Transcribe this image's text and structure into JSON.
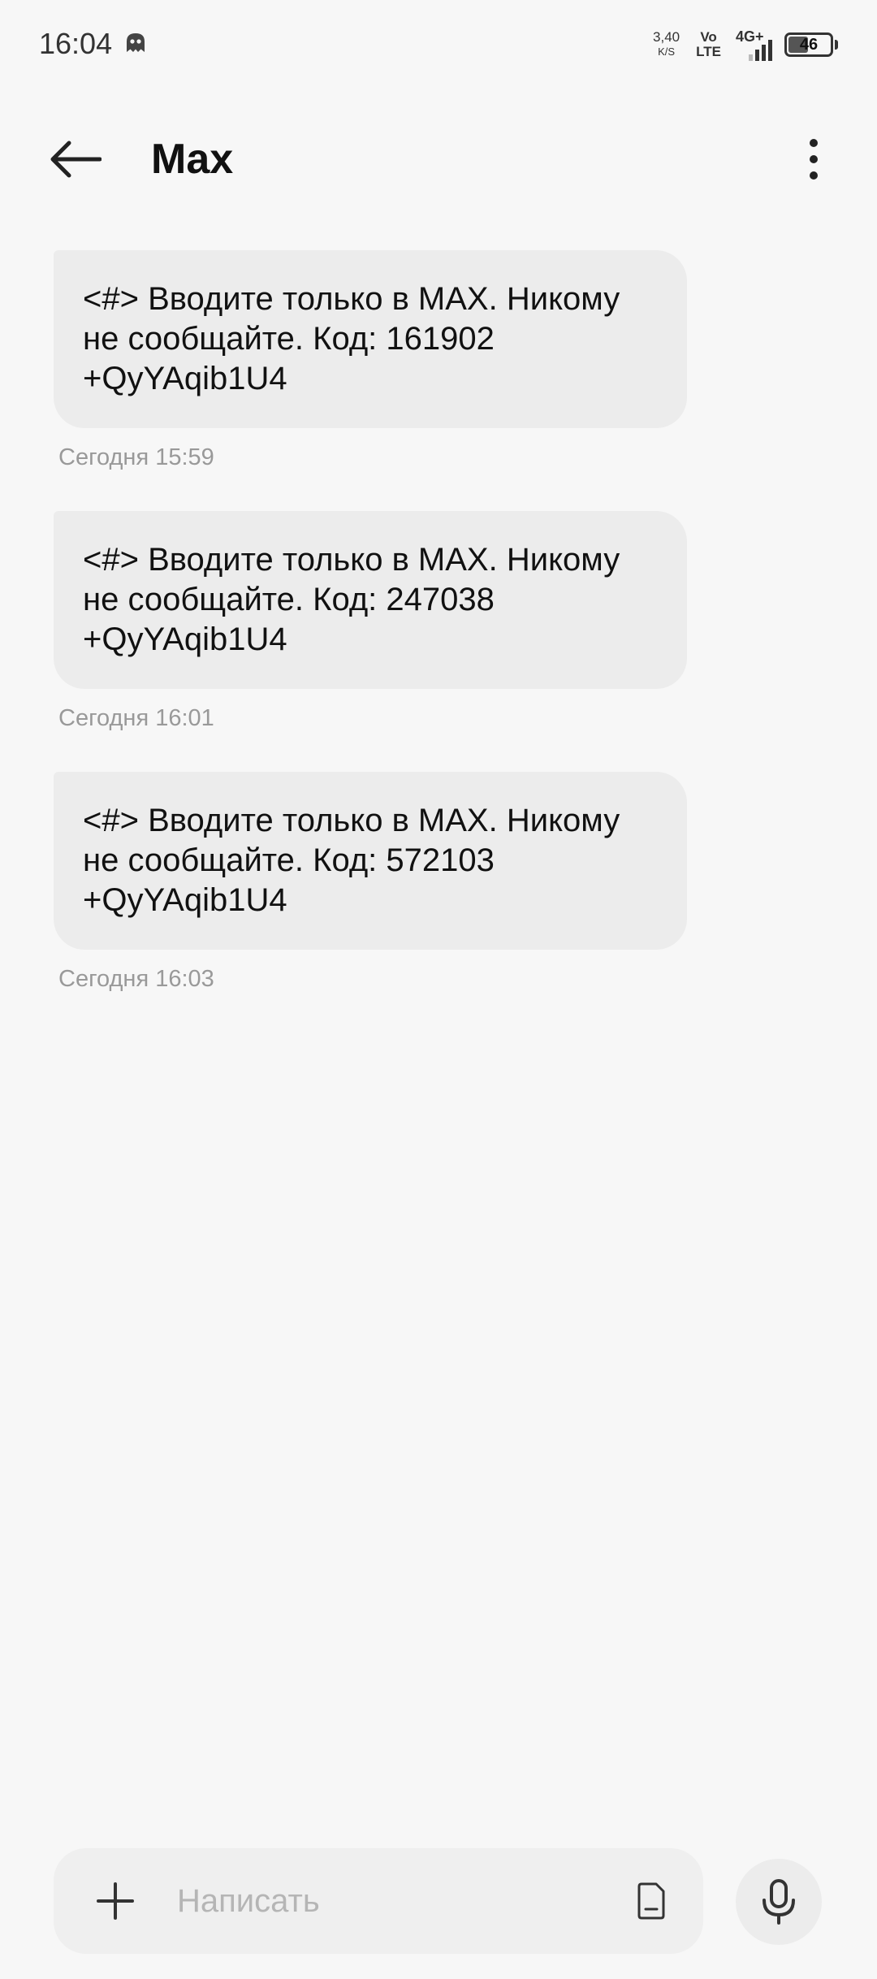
{
  "status_bar": {
    "time": "16:04",
    "net_speed_value": "3,40",
    "net_speed_unit": "K/S",
    "volte_top": "Vo",
    "volte_bottom": "LTE",
    "network": "4G+",
    "battery_level": "46",
    "app_icon": "ghost-icon"
  },
  "header": {
    "title": "Max",
    "back_icon": "back-arrow-icon",
    "more_icon": "more-vertical-icon"
  },
  "messages": [
    {
      "lines": [
        "<#> Вводите только в MAX. Никому",
        "не сообщайте. Код: 161902",
        "+QyYAqib1U4"
      ],
      "time": "Сегодня 15:59"
    },
    {
      "lines": [
        "<#> Вводите только в MAX. Никому",
        "не сообщайте. Код: 247038",
        "+QyYAqib1U4"
      ],
      "time": "Сегодня 16:01"
    },
    {
      "lines": [
        "<#> Вводите только в MAX. Никому",
        "не сообщайте. Код: 572103",
        "+QyYAqib1U4"
      ],
      "time": "Сегодня 16:03"
    }
  ],
  "composer": {
    "placeholder": "Написать",
    "value": "",
    "add_icon": "plus-icon",
    "sim_icon": "sim-card-icon",
    "mic_icon": "microphone-icon"
  },
  "colors": {
    "background": "#f7f7f7",
    "bubble": "#ececec",
    "timestamp": "#999999",
    "placeholder": "#b5b5b5"
  }
}
